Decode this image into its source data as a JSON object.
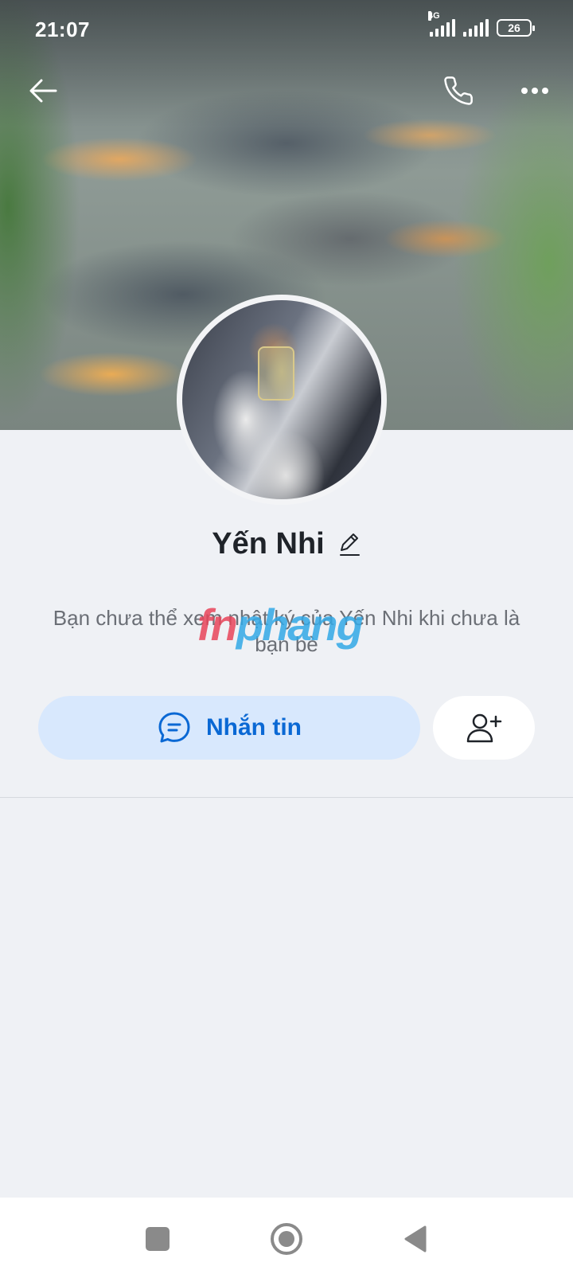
{
  "status_bar": {
    "time": "21:07",
    "network_label": "4G",
    "battery": "26"
  },
  "header": {
    "back_icon": "arrow-left-icon",
    "call_icon": "phone-icon",
    "more_icon": "more-horizontal-icon"
  },
  "profile": {
    "name": "Yến Nhi",
    "edit_icon": "pencil-icon",
    "privacy_notice": "Bạn chưa thể xem nhật ký của Yến Nhi khi chưa là bạn bè"
  },
  "watermark": {
    "part1": "fn",
    "part2": "phang"
  },
  "actions": {
    "message_label": "Nhắn tin",
    "message_icon": "chat-bubble-icon",
    "add_friend_icon": "user-plus-icon"
  },
  "colors": {
    "accent": "#0a68d4",
    "message_button_bg": "#d8e8fd",
    "page_bg": "#eff1f5"
  }
}
